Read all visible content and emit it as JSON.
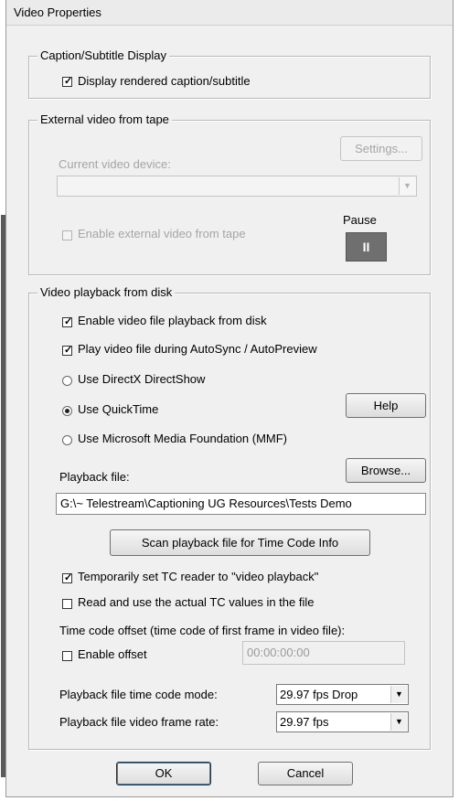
{
  "window": {
    "title": "Video Properties"
  },
  "caption_group": {
    "legend": "Caption/Subtitle Display",
    "display_rendered": {
      "label": "Display rendered caption/subtitle",
      "checked": true
    }
  },
  "external_group": {
    "legend": "External video from tape",
    "settings_label": "Settings...",
    "device_label": "Current video device:",
    "device_value": "",
    "enable_label": "Enable external video from tape",
    "pause_label": "Pause",
    "pause_glyph": "II"
  },
  "playback_group": {
    "legend": "Video playback from disk",
    "enable_playback": {
      "label": "Enable video file playback from disk",
      "checked": true
    },
    "play_during": {
      "label": "Play video file during AutoSync / AutoPreview",
      "checked": true
    },
    "radio_directshow": {
      "label": "Use DirectX DirectShow",
      "selected": false
    },
    "radio_quicktime": {
      "label": "Use QuickTime",
      "selected": true
    },
    "radio_mmf": {
      "label": "Use Microsoft Media Foundation (MMF)",
      "selected": false
    },
    "help_label": "Help",
    "playback_file_label": "Playback file:",
    "browse_label": "Browse...",
    "playback_file_value": "G:\\~ Telestream\\Captioning UG Resources\\Tests Demo",
    "scan_label": "Scan playback file for Time Code Info",
    "temp_tc": {
      "label": "Temporarily set TC reader to \"video playback\"",
      "checked": true
    },
    "read_tc": {
      "label": "Read and use the actual TC values in the file",
      "checked": false
    },
    "offset_label": "Time code offset (time code of first frame in video file):",
    "enable_offset": {
      "label": "Enable offset",
      "checked": false
    },
    "offset_value": "00:00:00:00",
    "tc_mode_label": "Playback file time code mode:",
    "tc_mode_value": "29.97 fps Drop",
    "frame_rate_label": "Playback file video frame rate:",
    "frame_rate_value": "29.97 fps"
  },
  "footer": {
    "ok_label": "OK",
    "cancel_label": "Cancel"
  }
}
